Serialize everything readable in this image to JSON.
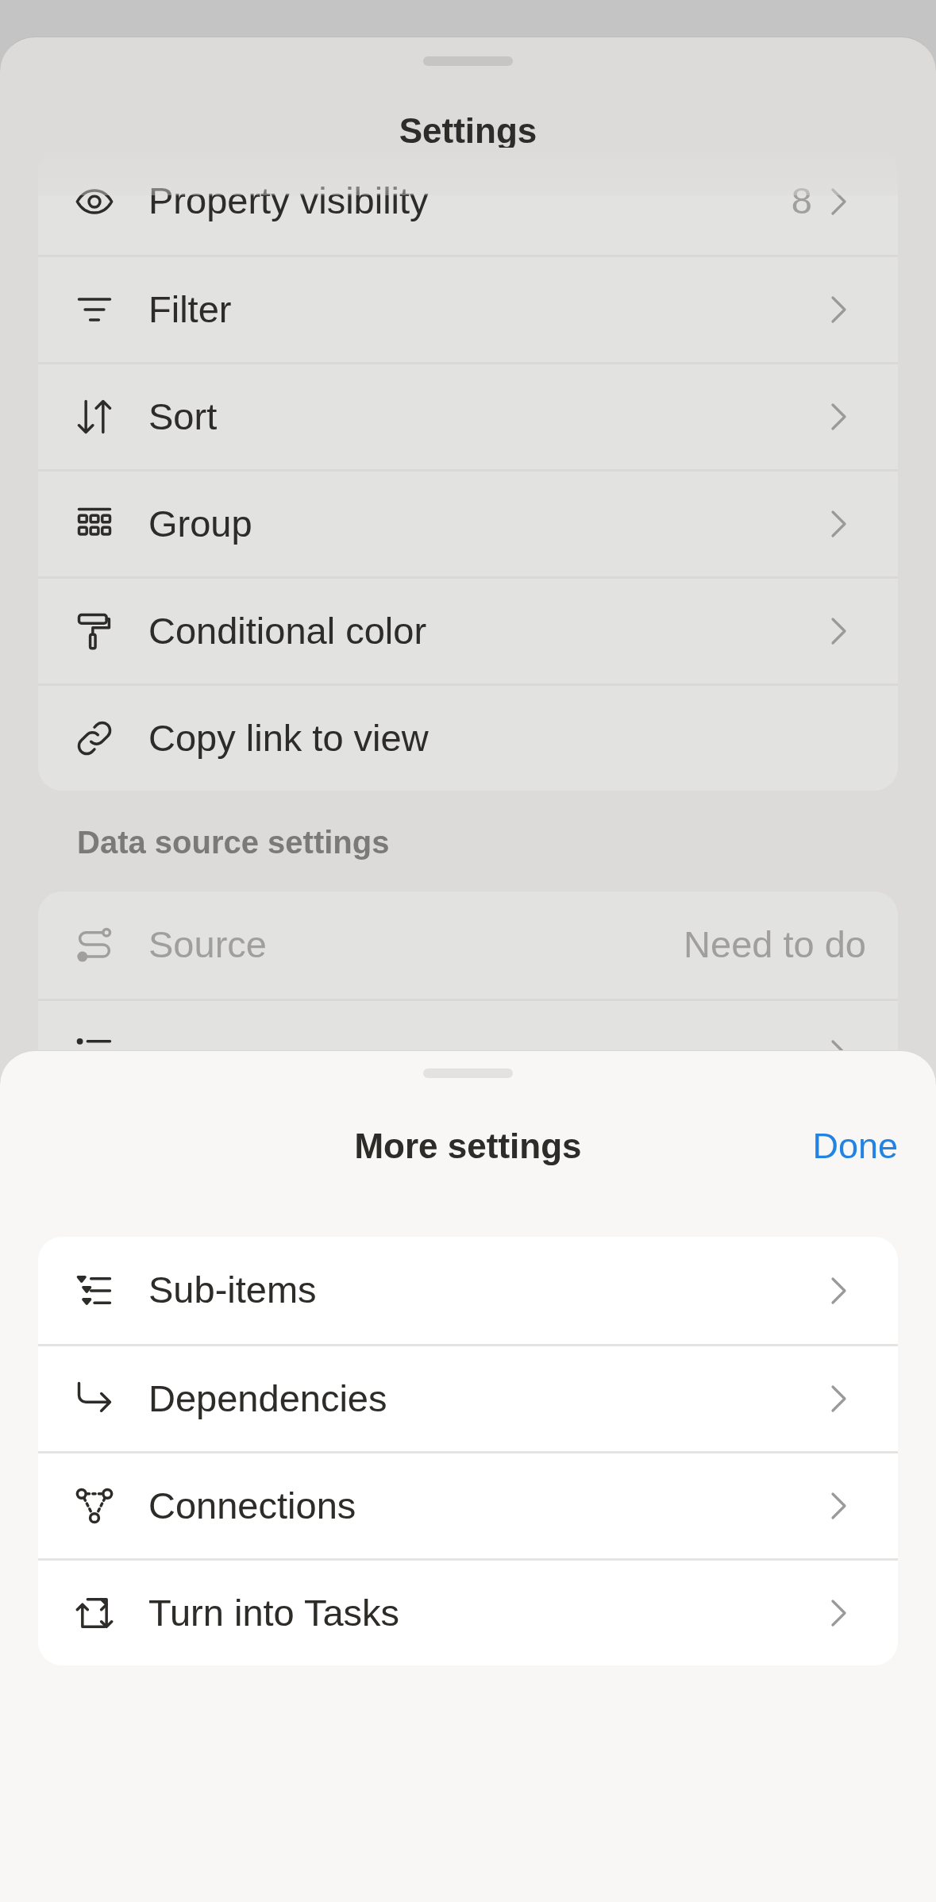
{
  "settings_sheet": {
    "title": "Settings",
    "view_rows": [
      {
        "label": "Property visibility",
        "value": "8",
        "chevron": true,
        "disabled": false
      },
      {
        "label": "Filter",
        "chevron": true,
        "disabled": false
      },
      {
        "label": "Sort",
        "chevron": true,
        "disabled": false
      },
      {
        "label": "Group",
        "chevron": true,
        "disabled": false
      },
      {
        "label": "Conditional color",
        "chevron": true,
        "disabled": false
      },
      {
        "label": "Copy link to view",
        "chevron": false,
        "disabled": false
      }
    ],
    "data_source_heading": "Data source settings",
    "data_source_rows": [
      {
        "label": "Source",
        "value": "Need to do",
        "chevron": false,
        "disabled": true
      },
      {
        "chevron": true,
        "disabled": false
      }
    ]
  },
  "more_settings_sheet": {
    "title": "More settings",
    "done": "Done",
    "rows": [
      {
        "label": "Sub-items",
        "chevron": true,
        "disabled": false
      },
      {
        "label": "Dependencies",
        "chevron": true,
        "disabled": false
      },
      {
        "label": "Connections",
        "chevron": true,
        "disabled": false
      },
      {
        "label": "Turn into Tasks",
        "chevron": true,
        "disabled": false
      }
    ]
  }
}
